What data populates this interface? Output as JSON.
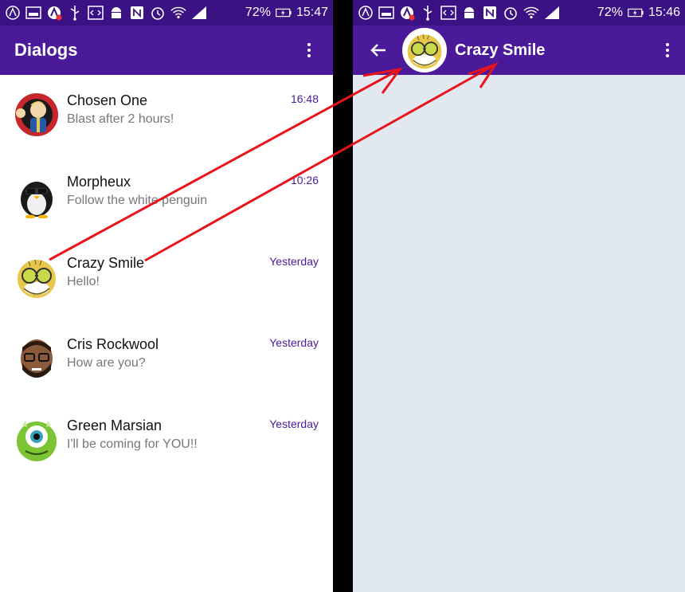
{
  "left_screen": {
    "status": {
      "battery": "72%",
      "time": "15:47"
    },
    "title": "Dialogs",
    "dialogs": [
      {
        "name": "Chosen One",
        "message": "Blast after 2 hours!",
        "time": "16:48",
        "avatar": "vault-boy-avatar"
      },
      {
        "name": "Morpheux",
        "message": "Follow the white penguin",
        "time": "10:26",
        "avatar": "penguin-avatar"
      },
      {
        "name": "Crazy Smile",
        "message": "Hello!",
        "time": "Yesterday",
        "avatar": "crazy-smile-avatar"
      },
      {
        "name": "Cris Rockwool",
        "message": "How are you?",
        "time": "Yesterday",
        "avatar": "bearded-man-avatar"
      },
      {
        "name": "Green Marsian",
        "message": "I'll be coming for YOU!!",
        "time": "Yesterday",
        "avatar": "green-monster-avatar"
      }
    ]
  },
  "right_screen": {
    "status": {
      "battery": "72%",
      "time": "15:46"
    },
    "chat_title": "Crazy Smile"
  },
  "colors": {
    "status_bar": "#3b1283",
    "app_bar": "#4a1a9a",
    "time_accent": "#4a1a9a",
    "chat_background": "#e2e8f0",
    "annotation_arrow": "#e8141b"
  }
}
